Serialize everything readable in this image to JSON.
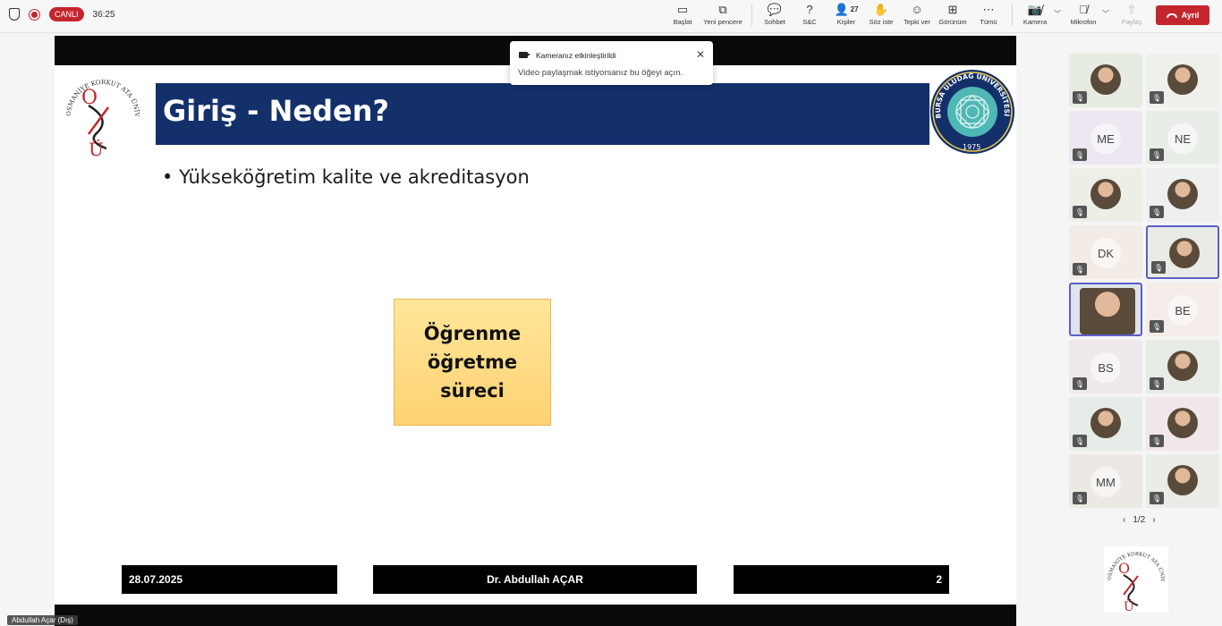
{
  "header": {
    "live_label": "CANLI",
    "timer": "36:25",
    "buttons": {
      "start": "Başlat",
      "new_window": "Yeni pencere",
      "chat": "Sohbet",
      "qa": "S&C",
      "people": "Kişiler",
      "people_count": "27",
      "raise_hand": "Söz iste",
      "react": "Tepki ver",
      "view": "Görünüm",
      "more": "Tümü",
      "camera": "Kamera",
      "mic": "Mikrofon",
      "share": "Paylaş",
      "leave": "Ayrıl"
    },
    "icons": {
      "shield": "shield-icon",
      "record": "record-icon",
      "camera_off": "camera-off-icon",
      "mic_off": "mic-off-icon"
    }
  },
  "toast": {
    "title": "Kameranız etkinleştirildi",
    "message": "Video paylaşmak istiyorsanız bu öğeyi açın.",
    "close": "✕"
  },
  "slide": {
    "title": "Giriş - Neden?",
    "bullet": "Yükseköğretim kalite ve akreditasyon",
    "box_text": "Öğrenme öğretme süreci",
    "footer_date": "28.07.2025",
    "footer_name": "Dr. Abdullah AÇAR",
    "footer_page": "2",
    "logo_left": "OSMANİYE KORKUT ATA ÜNİVERSİTESİ",
    "logo_right": "BURSA ULUDAĞ ÜNİVERSİTESİ",
    "logo_right_year": "1975",
    "colors": {
      "title_band": "#13306b",
      "box": "#ffd273",
      "live": "#c4262e"
    }
  },
  "participants": [
    {
      "type": "photo",
      "initials": ""
    },
    {
      "type": "photo",
      "initials": ""
    },
    {
      "type": "initials",
      "initials": "ME"
    },
    {
      "type": "initials",
      "initials": "NE"
    },
    {
      "type": "photo",
      "initials": ""
    },
    {
      "type": "photo",
      "initials": ""
    },
    {
      "type": "initials",
      "initials": "DK"
    },
    {
      "type": "photo",
      "initials": ""
    },
    {
      "type": "video",
      "initials": ""
    },
    {
      "type": "initials",
      "initials": "BE"
    },
    {
      "type": "initials",
      "initials": "BS"
    },
    {
      "type": "photo",
      "initials": ""
    },
    {
      "type": "photo",
      "initials": ""
    },
    {
      "type": "photo",
      "initials": ""
    },
    {
      "type": "initials",
      "initials": "MM"
    },
    {
      "type": "photo",
      "initials": ""
    }
  ],
  "pager": {
    "label": "1/2",
    "prev": "‹",
    "next": "›"
  },
  "presenter_name": "Abdullah Açar (Dış)"
}
